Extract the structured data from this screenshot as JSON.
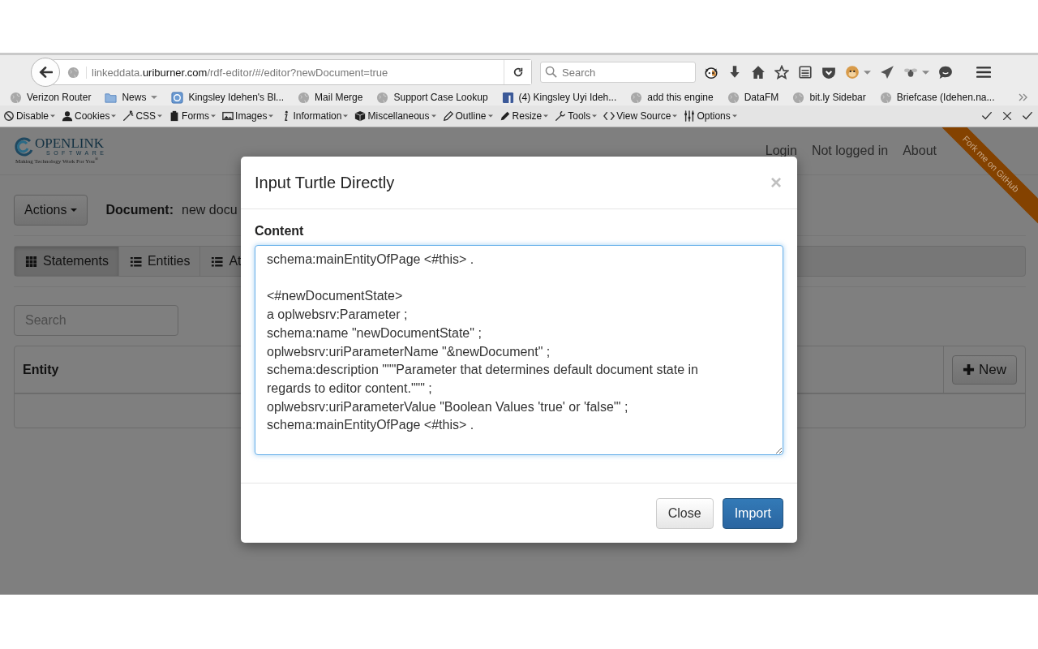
{
  "browser": {
    "url": {
      "subdomain": "linkeddata.",
      "domain": "uriburner.com",
      "path": "/rdf-editor/#/editor?newDocument=true"
    },
    "search": {
      "placeholder": "Search"
    },
    "toolbar_icons": [
      {
        "kind": "dog-face",
        "dropdown": false
      },
      {
        "kind": "download",
        "dropdown": false
      },
      {
        "kind": "home",
        "dropdown": false
      },
      {
        "kind": "star",
        "dropdown": false
      },
      {
        "kind": "reader-list",
        "dropdown": false
      },
      {
        "kind": "shield",
        "dropdown": false
      },
      {
        "kind": "monkey-face",
        "dropdown": true
      },
      {
        "kind": "paper-plane",
        "dropdown": false
      },
      {
        "kind": "fly",
        "dropdown": true
      },
      {
        "kind": "chat",
        "dropdown": false
      },
      {
        "kind": "menu",
        "dropdown": false
      }
    ],
    "bookmarks": [
      {
        "label": "Verizon Router",
        "kind": "globe",
        "dropdown": false
      },
      {
        "label": "News",
        "kind": "folder",
        "dropdown": true
      },
      {
        "label": "Kingsley Idehen's Bl...",
        "kind": "app-square",
        "dropdown": false
      },
      {
        "label": "Mail Merge",
        "kind": "globe",
        "dropdown": false
      },
      {
        "label": "Support Case Lookup",
        "kind": "globe",
        "dropdown": false
      },
      {
        "label": "(4) Kingsley Uyi Ideh...",
        "kind": "social-square",
        "dropdown": false
      },
      {
        "label": "add this engine",
        "kind": "globe",
        "dropdown": false
      },
      {
        "label": "DataFM",
        "kind": "globe",
        "dropdown": false
      },
      {
        "label": "bit.ly Sidebar",
        "kind": "globe",
        "dropdown": false
      },
      {
        "label": "Briefcase (Idehen.na...",
        "kind": "globe",
        "dropdown": false
      }
    ],
    "dev_toolbar": [
      {
        "label": "Disable",
        "kind": "no-entry"
      },
      {
        "label": "Cookies",
        "kind": "person"
      },
      {
        "label": "CSS",
        "kind": "magic-wand"
      },
      {
        "label": "Forms",
        "kind": "clipboard"
      },
      {
        "label": "Images",
        "kind": "picture"
      },
      {
        "label": "Information",
        "kind": "info"
      },
      {
        "label": "Miscellaneous",
        "kind": "cube"
      },
      {
        "label": "Outline",
        "kind": "pencil"
      },
      {
        "label": "Resize",
        "kind": "marker"
      },
      {
        "label": "Tools",
        "kind": "wrench"
      },
      {
        "label": "View Source",
        "kind": "code"
      },
      {
        "label": "Options",
        "kind": "sliders"
      }
    ],
    "dev_toolbar_end": [
      {
        "kind": "check"
      },
      {
        "kind": "close"
      },
      {
        "kind": "check"
      }
    ]
  },
  "page": {
    "logo": {
      "name": "OPENLINK",
      "sub": "SOFTWARE",
      "tagline": "Making Technology Work For You$^{®}$"
    },
    "nav": [
      "Login",
      "Not logged in",
      "About"
    ],
    "ribbon": "Fork me on GitHub",
    "actions": "Actions",
    "document": {
      "label": "Document:",
      "value": "new docu"
    },
    "tabs": [
      {
        "label": "Statements",
        "kind": "grid",
        "selected": true
      },
      {
        "label": "Entities",
        "kind": "list",
        "selected": false
      },
      {
        "label": "At",
        "kind": "list",
        "selected": false
      }
    ],
    "search": {
      "placeholder": "Search"
    },
    "table": {
      "columns": [
        "Entity"
      ],
      "new_button": "New"
    }
  },
  "modal": {
    "title": "Input Turtle Directly",
    "close": "×",
    "label": "Content",
    "blocks": [
      [
        "schema:mainEntityOfPage <#this> ."
      ],
      [
        "<#newDocumentState>",
        "a oplwebsrv:Parameter ;",
        "schema:name \"newDocumentState\" ;",
        "oplwebsrv:uriParameterName \"&newDocument\" ;",
        "schema:description \"\"\"Parameter that determines default document state in regards to editor content.\"\"\" ;",
        "oplwebsrv:uriParameterValue \"Boolean Values 'true' or 'false'\" ;",
        "schema:mainEntityOfPage <#this> ."
      ]
    ],
    "buttons": [
      {
        "label": "Close",
        "kind": "default"
      },
      {
        "label": "Import",
        "kind": "primary"
      }
    ]
  }
}
